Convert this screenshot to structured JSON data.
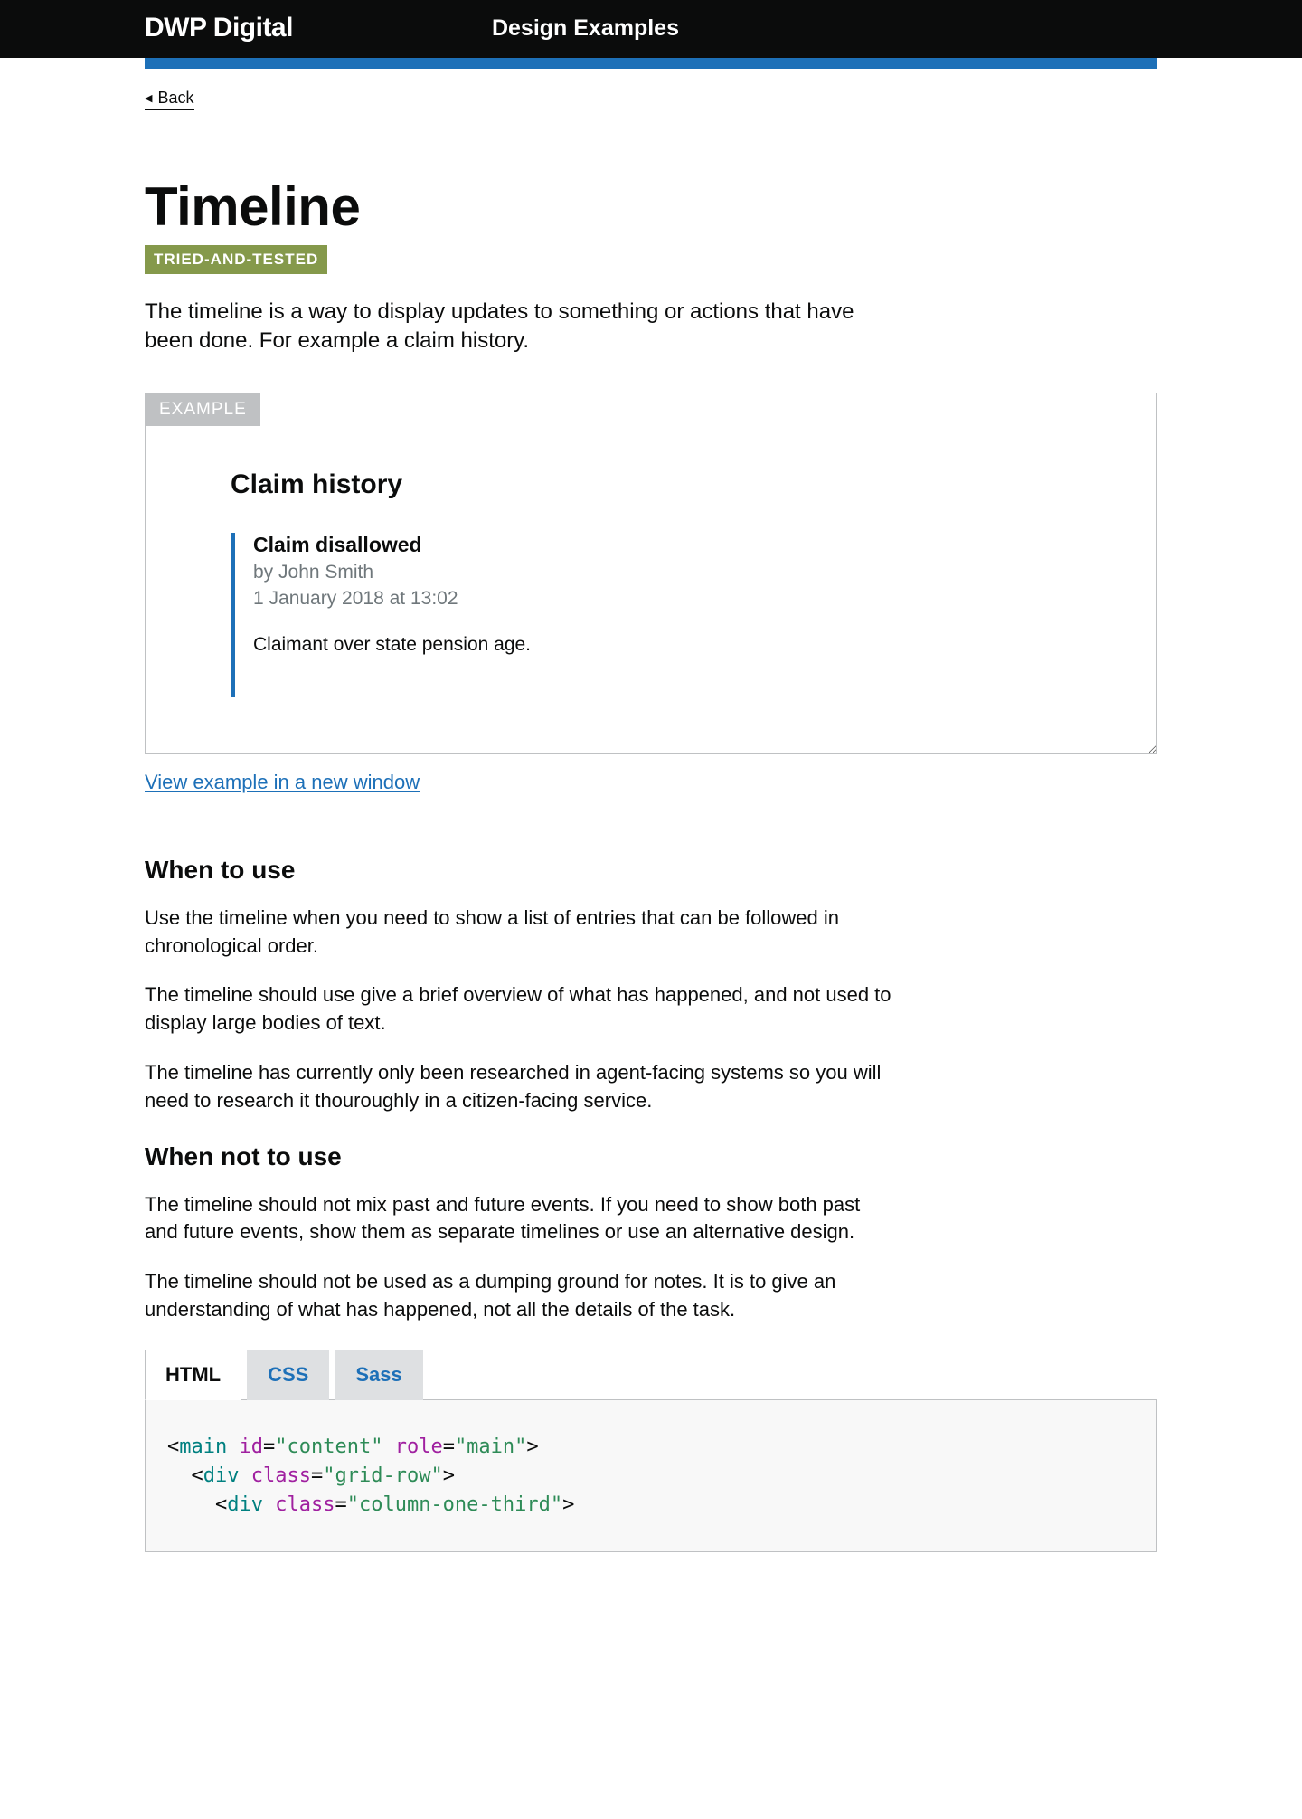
{
  "header": {
    "logo": "DWP Digital",
    "link": "Design Examples"
  },
  "back_label": "Back",
  "title": "Timeline",
  "phase": "TRIED-AND-TESTED",
  "intro": "The timeline is a way to display updates to something or actions that have been done. For example a claim history.",
  "example_tag": "EXAMPLE",
  "example": {
    "heading": "Claim history",
    "entry": {
      "title": "Claim disallowed",
      "by": "by John Smith",
      "datetime": "1 January 2018 at 13:02",
      "body": "Claimant over state pension age."
    }
  },
  "new_window_link": "View example in a new window",
  "sections": {
    "when_to_use_heading": "When to use",
    "when_to_use": [
      "Use the timeline when you need to show a list of entries that can be followed in chronological order.",
      "The timeline should use give a brief overview of what has happened, and not used to display large bodies of text.",
      "The timeline has currently only been researched in agent-facing systems so you will need to research it thouroughly in a citizen-facing service."
    ],
    "when_not_heading": "When not to use",
    "when_not": [
      "The timeline should not mix past and future events. If you need to show both past and future events, show them as separate timelines or use an alternative design.",
      "The timeline should not be used as a dumping ground for notes. It is to give an understanding of what has happened, not all the details of the task."
    ]
  },
  "tabs": {
    "html": "HTML",
    "css": "CSS",
    "sass": "Sass"
  },
  "code": {
    "lines": [
      {
        "indent": 0,
        "tag": "main",
        "attrs": [
          {
            "name": "id",
            "value": "content"
          },
          {
            "name": "role",
            "value": "main"
          }
        ]
      },
      {
        "indent": 1,
        "tag": "div",
        "attrs": [
          {
            "name": "class",
            "value": "grid-row"
          }
        ]
      },
      {
        "indent": 2,
        "tag": "div",
        "attrs": [
          {
            "name": "class",
            "value": "column-one-third"
          }
        ]
      }
    ]
  }
}
